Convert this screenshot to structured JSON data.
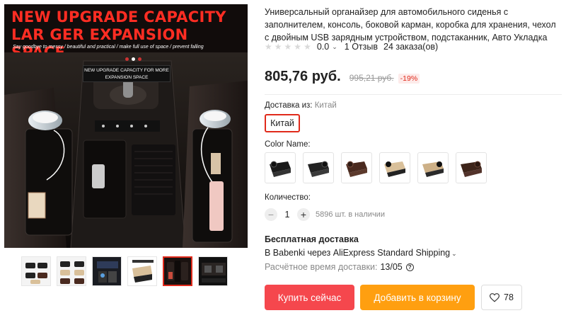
{
  "gallery": {
    "main_image": {
      "headline": "NEW UPGRADE CAPACITY LAR GER EXPANSION SPACE",
      "tagline": "Say goodbye to messy / beautiful and practical / make full use of space / prevent falling",
      "ribbon": "NEW UPGRADE CAPACITY FOR MORE EXPANSION SPACE"
    },
    "thumbnails": [
      {
        "name": "thumb-1",
        "active": false
      },
      {
        "name": "thumb-2",
        "active": false
      },
      {
        "name": "thumb-3",
        "active": false
      },
      {
        "name": "thumb-4",
        "active": false
      },
      {
        "name": "thumb-5",
        "active": true
      },
      {
        "name": "thumb-6",
        "active": false
      }
    ]
  },
  "product": {
    "title": "Универсальный органайзер для автомобильного сиденья с заполнителем, консоль, боковой карман, коробка для хранения, чехол с двойным USB зарядным устройством, подстаканник, Авто Укладка",
    "rating": "0.0",
    "reviews": "1 Отзыв",
    "orders": "24 заказа(ов)",
    "price": "805,76 руб.",
    "old_price": "995,21 руб.",
    "discount": "-19%"
  },
  "shipping_from": {
    "label": "Доставка из:",
    "value": "Китай",
    "selected_option": "Китай"
  },
  "color": {
    "label": "Color Name:",
    "swatches": [
      {
        "name": "black-1",
        "color": "#1a1a1a"
      },
      {
        "name": "black-2",
        "color": "#222222"
      },
      {
        "name": "coffee",
        "color": "#4a2a1f"
      },
      {
        "name": "beige-1",
        "color": "#d9c09a"
      },
      {
        "name": "beige-2",
        "color": "#cdb087"
      },
      {
        "name": "coffee-2",
        "color": "#3d2419"
      }
    ]
  },
  "quantity": {
    "label": "Количество:",
    "minus": "−",
    "value": "1",
    "plus": "+",
    "stock": "5896 шт. в наличии"
  },
  "delivery": {
    "free": "Бесплатная доставка",
    "method": "В Babenki через AliExpress Standard Shipping",
    "time_label": "Расчётное время доставки:",
    "time_value": "13/05",
    "help": "?"
  },
  "actions": {
    "buy": "Купить сейчас",
    "cart": "Добавить в корзину",
    "wishlist_count": "78"
  },
  "colors": {
    "accent_red": "#f5474d",
    "accent_orange": "#ff9f10",
    "selected_border": "#e02a1b"
  }
}
